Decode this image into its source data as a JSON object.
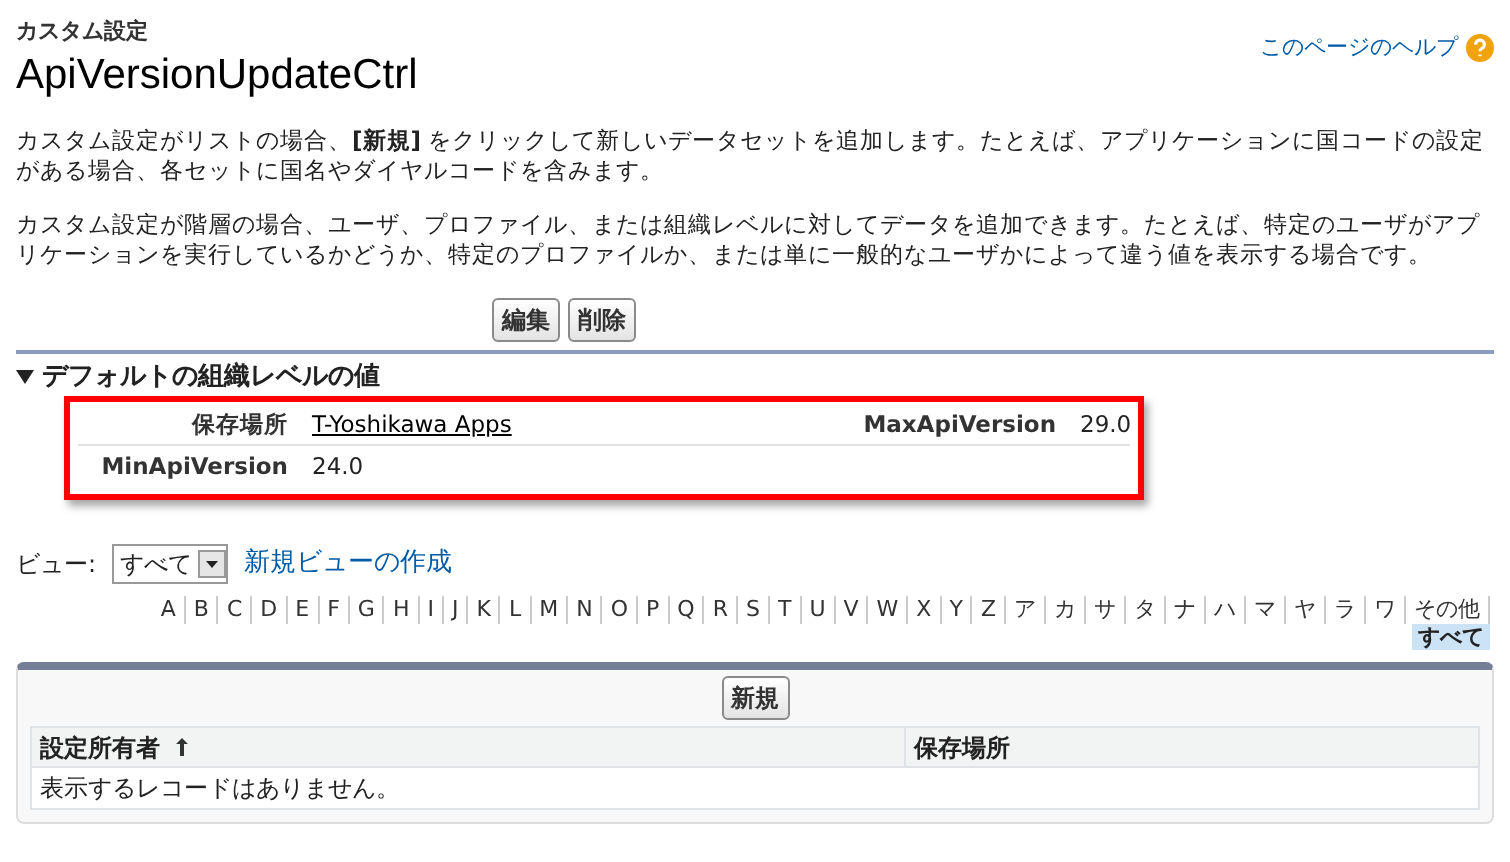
{
  "header": {
    "subtitle": "カスタム設定",
    "title": "ApiVersionUpdateCtrl",
    "help_link": "このページのヘルプ"
  },
  "descriptions": [
    "カスタム設定がリストの場合、**[新規]** をクリックして新しいデータセットを追加します。たとえば、アプリケーションに国コードの設定がある場合、各セットに国名やダイヤルコードを含みます。",
    "カスタム設定が階層の場合、ユーザ、プロファイル、または組織レベルに対してデータを追加できます。たとえば、特定のユーザがアプリケーションを実行しているかどうか、特定のプロファイルか、または単に一般的なユーザかによって違う値を表示する場合です。"
  ],
  "buttons": [
    "編集",
    "削除"
  ],
  "section": {
    "title": "デフォルトの組織レベルの値",
    "expanded": true,
    "fields": [
      {
        "label": "保存場所",
        "value": "T-Yoshikawa Apps",
        "kind": "link"
      },
      {
        "label": "MaxApiVersion",
        "value": "29.0",
        "kind": "text"
      },
      {
        "label": "MinApiVersion",
        "value": "24.0",
        "kind": "text"
      }
    ]
  },
  "view": {
    "label": "ビュー:",
    "selected_view": "すべて",
    "create_link": "新規ビューの作成"
  },
  "alpha_filter": [
    {
      "label": "A",
      "selected": false
    },
    {
      "label": "B",
      "selected": false
    },
    {
      "label": "C",
      "selected": false
    },
    {
      "label": "D",
      "selected": false
    },
    {
      "label": "E",
      "selected": false
    },
    {
      "label": "F",
      "selected": false
    },
    {
      "label": "G",
      "selected": false
    },
    {
      "label": "H",
      "selected": false
    },
    {
      "label": "I",
      "selected": false
    },
    {
      "label": "J",
      "selected": false
    },
    {
      "label": "K",
      "selected": false
    },
    {
      "label": "L",
      "selected": false
    },
    {
      "label": "M",
      "selected": false
    },
    {
      "label": "N",
      "selected": false
    },
    {
      "label": "O",
      "selected": false
    },
    {
      "label": "P",
      "selected": false
    },
    {
      "label": "Q",
      "selected": false
    },
    {
      "label": "R",
      "selected": false
    },
    {
      "label": "S",
      "selected": false
    },
    {
      "label": "T",
      "selected": false
    },
    {
      "label": "U",
      "selected": false
    },
    {
      "label": "V",
      "selected": false
    },
    {
      "label": "W",
      "selected": false
    },
    {
      "label": "X",
      "selected": false
    },
    {
      "label": "Y",
      "selected": false
    },
    {
      "label": "Z",
      "selected": false
    },
    {
      "label": "ア",
      "selected": false
    },
    {
      "label": "カ",
      "selected": false
    },
    {
      "label": "サ",
      "selected": false
    },
    {
      "label": "タ",
      "selected": false
    },
    {
      "label": "ナ",
      "selected": false
    },
    {
      "label": "ハ",
      "selected": false
    },
    {
      "label": "マ",
      "selected": false
    },
    {
      "label": "ヤ",
      "selected": false
    },
    {
      "label": "ラ",
      "selected": false
    },
    {
      "label": "ワ",
      "selected": false
    },
    {
      "label": "その他",
      "selected": false
    },
    {
      "label": "すべて",
      "selected": true
    }
  ],
  "list": {
    "new_button": "新規",
    "columns": [
      {
        "label": "設定所有者",
        "sorted": true
      },
      {
        "label": "保存場所",
        "sorted": false
      }
    ],
    "empty_message": "表示するレコードはありません。"
  }
}
